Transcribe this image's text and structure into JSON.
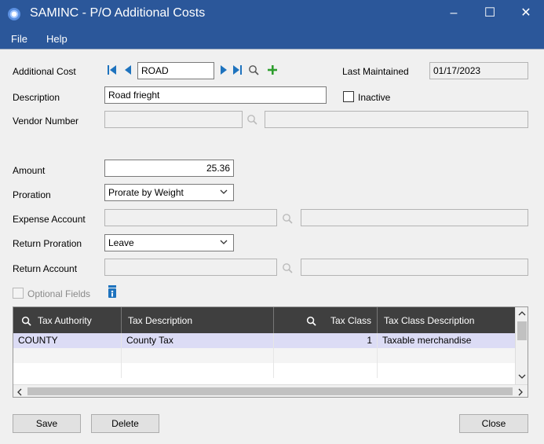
{
  "window": {
    "title": "SAMINC - P/O Additional Costs",
    "minimize_glyph": "–",
    "maximize_glyph": "☐",
    "close_glyph": "✕",
    "accent": "#2b579a"
  },
  "menu": {
    "items": [
      "File",
      "Help"
    ]
  },
  "form": {
    "additional_cost": {
      "label": "Additional Cost",
      "value": "ROAD"
    },
    "last_maintained": {
      "label": "Last Maintained",
      "value": "01/17/2023"
    },
    "description": {
      "label": "Description",
      "value": "Road frieght"
    },
    "inactive": {
      "label": "Inactive",
      "checked": false
    },
    "vendor_number": {
      "label": "Vendor Number",
      "value": "",
      "name": ""
    },
    "amount": {
      "label": "Amount",
      "value": "25.36"
    },
    "proration": {
      "label": "Proration",
      "value": "Prorate by Weight"
    },
    "expense_account": {
      "label": "Expense Account",
      "value": "",
      "description": ""
    },
    "return_proration": {
      "label": "Return Proration",
      "value": "Leave"
    },
    "return_account": {
      "label": "Return Account",
      "value": "",
      "description": ""
    },
    "optional_fields": {
      "label": "Optional Fields",
      "checked": false
    }
  },
  "icons": {
    "first": "first-record-icon",
    "previous": "previous-record-icon",
    "next": "next-record-icon",
    "last": "last-record-icon",
    "finder": "magnifier-icon",
    "new": "plus-icon",
    "zoom": "zoom-info-icon",
    "nav_color": "#1e73be",
    "add_color": "#2e9e2e"
  },
  "tax_grid": {
    "columns": [
      "Tax Authority",
      "Tax Description",
      "Tax Class",
      "Tax Class Description"
    ],
    "rows": [
      {
        "authority": "COUNTY",
        "description": "County Tax",
        "class": "1",
        "class_description": "Taxable merchandise"
      }
    ],
    "selected_row_color": "#dcdcf5"
  },
  "buttons": {
    "save": "Save",
    "delete": "Delete",
    "close": "Close"
  }
}
